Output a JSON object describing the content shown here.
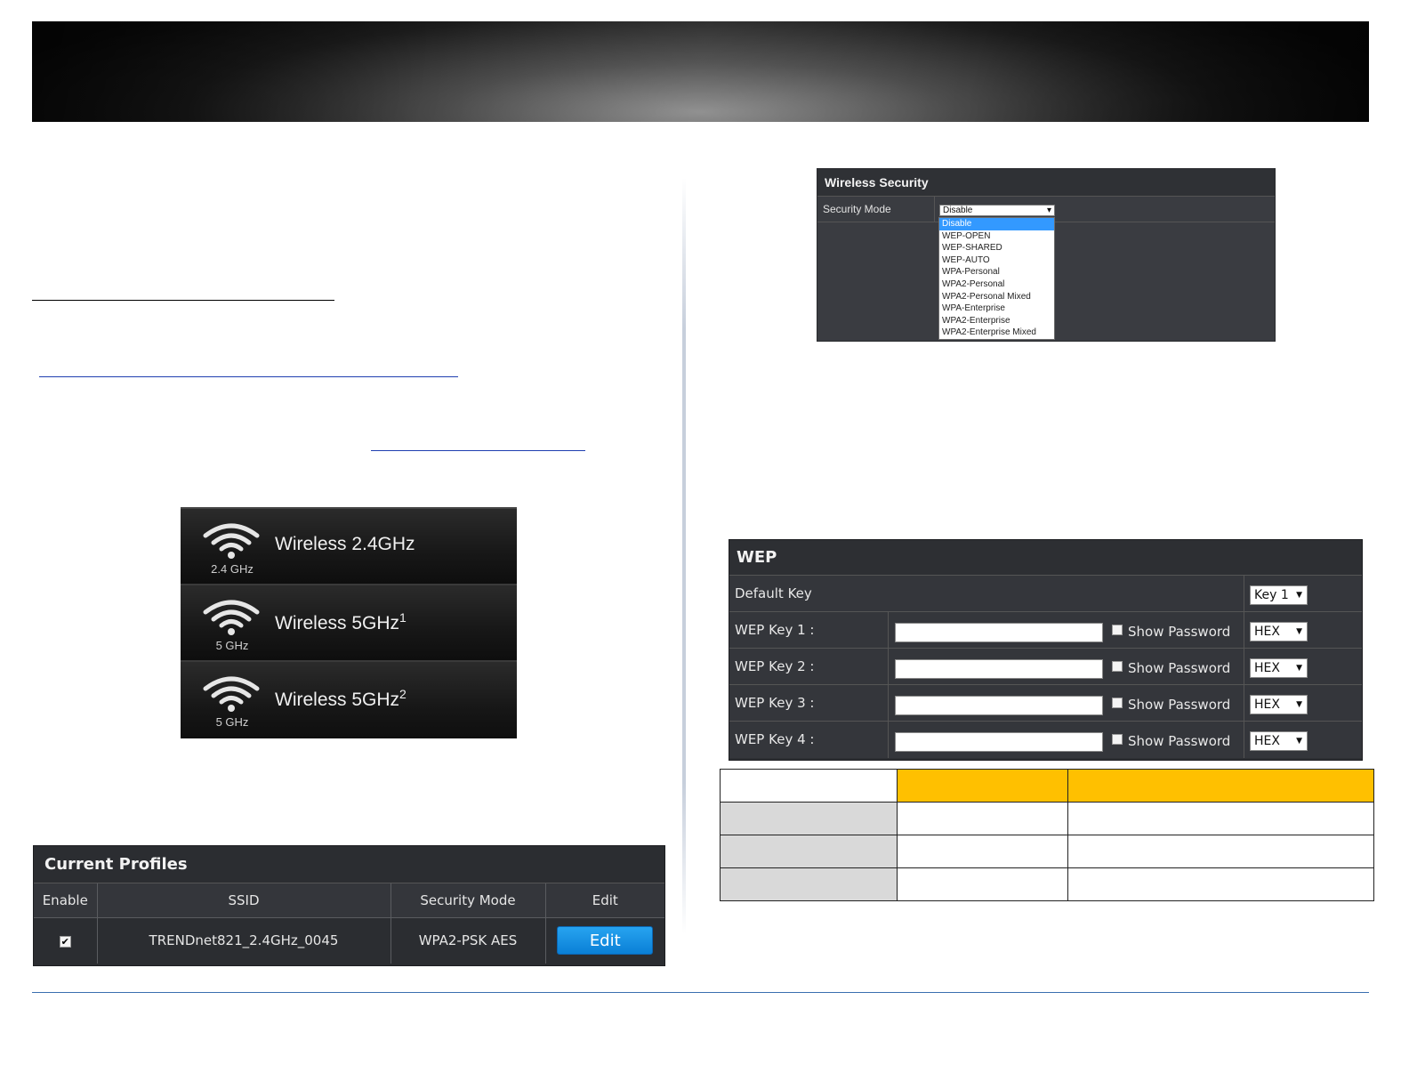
{
  "bands": {
    "items": [
      {
        "sub": "2.4 GHz",
        "label": "Wireless 2.4GHz",
        "sup": ""
      },
      {
        "sub": "5 GHz",
        "label": "Wireless 5GHz",
        "sup": "1"
      },
      {
        "sub": "5 GHz",
        "label": "Wireless 5GHz",
        "sup": "2"
      }
    ]
  },
  "profiles": {
    "title": "Current Profiles",
    "headers": [
      "Enable",
      "SSID",
      "Security Mode",
      "Edit"
    ],
    "row": {
      "enabled": "✔",
      "ssid": "TRENDnet821_2.4GHz_0045",
      "security_mode": "WPA2-PSK AES",
      "edit_label": "Edit"
    }
  },
  "wireless_security": {
    "title": "Wireless Security",
    "mode_label": "Security Mode",
    "selected": "Disable",
    "options": [
      "Disable",
      "WEP-OPEN",
      "WEP-SHARED",
      "WEP-AUTO",
      "WPA-Personal",
      "WPA2-Personal",
      "WPA2-Personal Mixed",
      "WPA-Enterprise",
      "WPA2-Enterprise",
      "WPA2-Enterprise Mixed"
    ]
  },
  "wep": {
    "title": "WEP",
    "default_key_label": "Default Key",
    "default_key_value": "Key 1",
    "show_password_label": "Show Password",
    "keys": [
      {
        "label": "WEP Key 1 :",
        "format": "HEX"
      },
      {
        "label": "WEP Key 2 :",
        "format": "HEX"
      },
      {
        "label": "WEP Key 3 :",
        "format": "HEX"
      },
      {
        "label": "WEP Key 4 :",
        "format": "HEX"
      }
    ]
  },
  "colors": {
    "table_header": "#ffc000",
    "table_row_label": "#d9d9d9",
    "edit_button": "#0a7fd6"
  }
}
